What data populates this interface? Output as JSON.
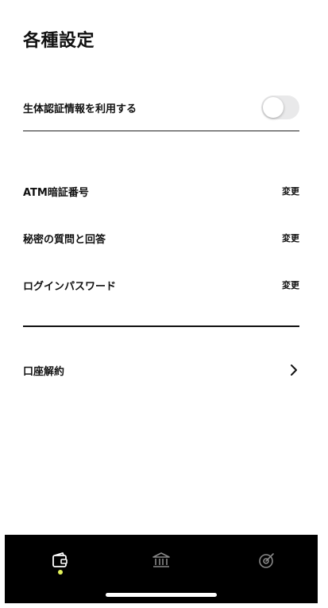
{
  "header": {
    "title": "各種設定"
  },
  "biometric": {
    "label": "生体認証情報を利用する",
    "enabled": false
  },
  "security_items": [
    {
      "label": "ATM暗証番号",
      "action": "変更"
    },
    {
      "label": "秘密の質問と回答",
      "action": "変更"
    },
    {
      "label": "ログインパスワード",
      "action": "変更"
    }
  ],
  "close_account": {
    "label": "口座解約"
  },
  "tabbar": {
    "tabs": [
      {
        "icon": "wallet-icon",
        "active": true
      },
      {
        "icon": "bank-icon",
        "active": false
      },
      {
        "icon": "target-icon",
        "active": false
      }
    ],
    "active_color": "#e2f25a"
  }
}
